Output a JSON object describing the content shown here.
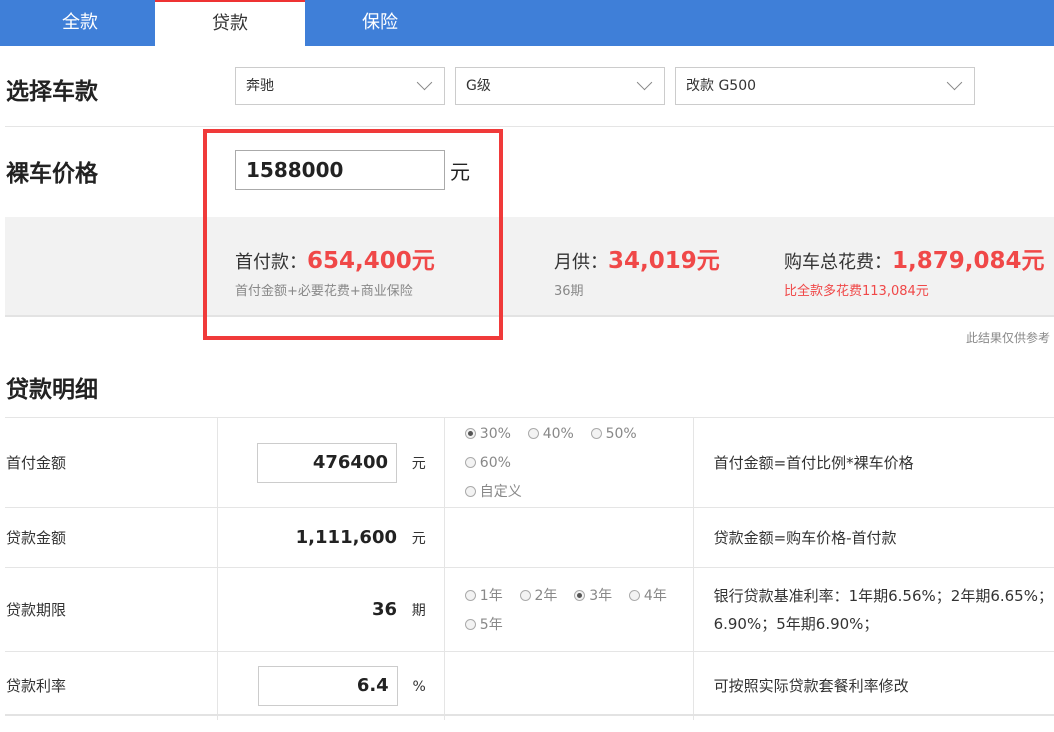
{
  "tabs": [
    {
      "label": "全款"
    },
    {
      "label": "贷款",
      "active": true
    },
    {
      "label": "保险"
    }
  ],
  "select_car": {
    "title": "选择车款",
    "brand": "奔驰",
    "series": "G级",
    "model": "改款 G500"
  },
  "bare_price": {
    "title": "裸车价格",
    "value": "1588000",
    "unit": "元"
  },
  "summary": {
    "down_label": "首付款：",
    "down_value": "654,400元",
    "down_sub": "首付金额+必要花费+商业保险",
    "monthly_label": "月供：",
    "monthly_value": "34,019元",
    "monthly_sub": "36期",
    "total_label": "购车总花费：",
    "total_value": "1,879,084元",
    "total_sub": "比全款多花费113,084元"
  },
  "note": "此结果仅供参考",
  "details": {
    "title": "贷款明细",
    "rows": [
      {
        "label": "首付金额",
        "value": "476400",
        "unit": "元",
        "options": [
          "30%",
          "40%",
          "50%",
          "60%",
          "自定义"
        ],
        "selected": "30%",
        "formula": "首付金额=首付比例*裸车价格"
      },
      {
        "label": "贷款金额",
        "value": "1,111,600",
        "unit": "元",
        "formula": "贷款金额=购车价格-首付款"
      },
      {
        "label": "贷款期限",
        "value": "36",
        "unit": "期",
        "options": [
          "1年",
          "2年",
          "3年",
          "4年",
          "5年"
        ],
        "selected": "3年",
        "formula_line1": "银行贷款基准利率：1年期6.56%；2年期6.65%；",
        "formula_line2": "6.90%；5年期6.90%；"
      },
      {
        "label": "贷款利率",
        "value": "6.4",
        "unit": "%",
        "formula": "可按照实际贷款套餐利率修改"
      }
    ]
  },
  "colors": {
    "tab_bar": "#3f7fd8",
    "accent_red": "#f04848",
    "highlight_box": "#f03a3a"
  }
}
